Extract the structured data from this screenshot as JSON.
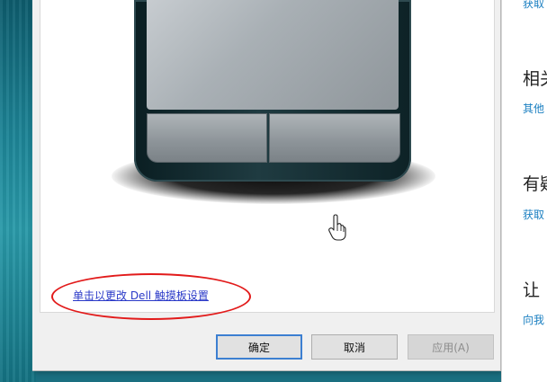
{
  "dialog": {
    "link_text": "单击以更改 Dell 触摸板设置",
    "buttons": {
      "ok": "确定",
      "cancel": "取消",
      "apply": "应用(A)"
    }
  },
  "settings_panel": {
    "items": [
      {
        "text": "获取",
        "kind": "link"
      },
      {
        "text": "相关",
        "kind": "heading"
      },
      {
        "text": "其他",
        "kind": "link"
      },
      {
        "text": "有疑",
        "kind": "heading"
      },
      {
        "text": "获取",
        "kind": "link"
      },
      {
        "text": "让",
        "kind": "heading"
      },
      {
        "text": "向我",
        "kind": "link"
      }
    ]
  },
  "colors": {
    "link": "#2a39c8",
    "annotation_oval": "#e21b1b",
    "settings_link": "#1a7fc1",
    "primary_button_border": "#3c7fd1"
  }
}
